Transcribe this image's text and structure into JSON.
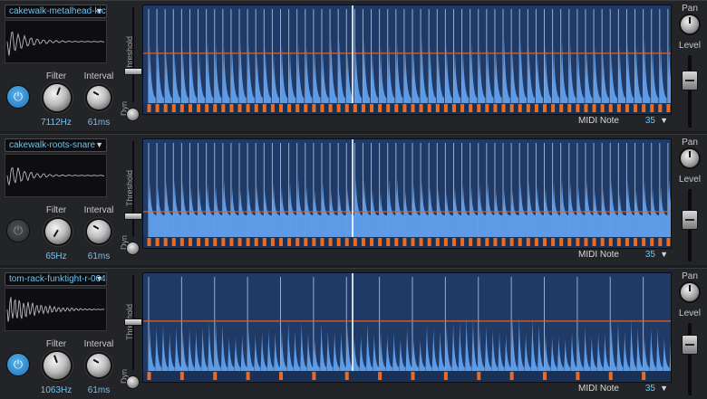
{
  "colors": {
    "background": "#1b1c1e",
    "display_bg": "#1f3a66",
    "waveform": "#5d9be6",
    "threshold_line": "#e0612a",
    "trigger_marker": "#ee6a1f",
    "accent_text": "#6ec3f2"
  },
  "labels": {
    "filter": "Filter",
    "interval": "Interval",
    "threshold": "Threshold",
    "dyn": "Dyn",
    "pan": "Pan",
    "level": "Level",
    "midi_note": "MIDI Note"
  },
  "tracks": [
    {
      "sample_name": "cakewalk-metalhead-kic",
      "power_on": true,
      "filter_value": "7112Hz",
      "interval_value": "61ms",
      "midi_note_value": "35",
      "threshold_level": 0.53,
      "level": 0.7,
      "hit_count": 64,
      "hit_style": "kick"
    },
    {
      "sample_name": "cakewalk-roots-snare",
      "power_on": false,
      "filter_value": "65Hz",
      "interval_value": "61ms",
      "midi_note_value": "35",
      "threshold_level": 0.27,
      "level": 0.6,
      "hit_count": 64,
      "hit_style": "snare"
    },
    {
      "sample_name": "tom-rack-funktight-r-004",
      "power_on": true,
      "filter_value": "1063Hz",
      "interval_value": "61ms",
      "midi_note_value": "35",
      "threshold_level": 0.53,
      "level": 0.78,
      "hit_count": 16,
      "hit_style": "tom"
    }
  ]
}
